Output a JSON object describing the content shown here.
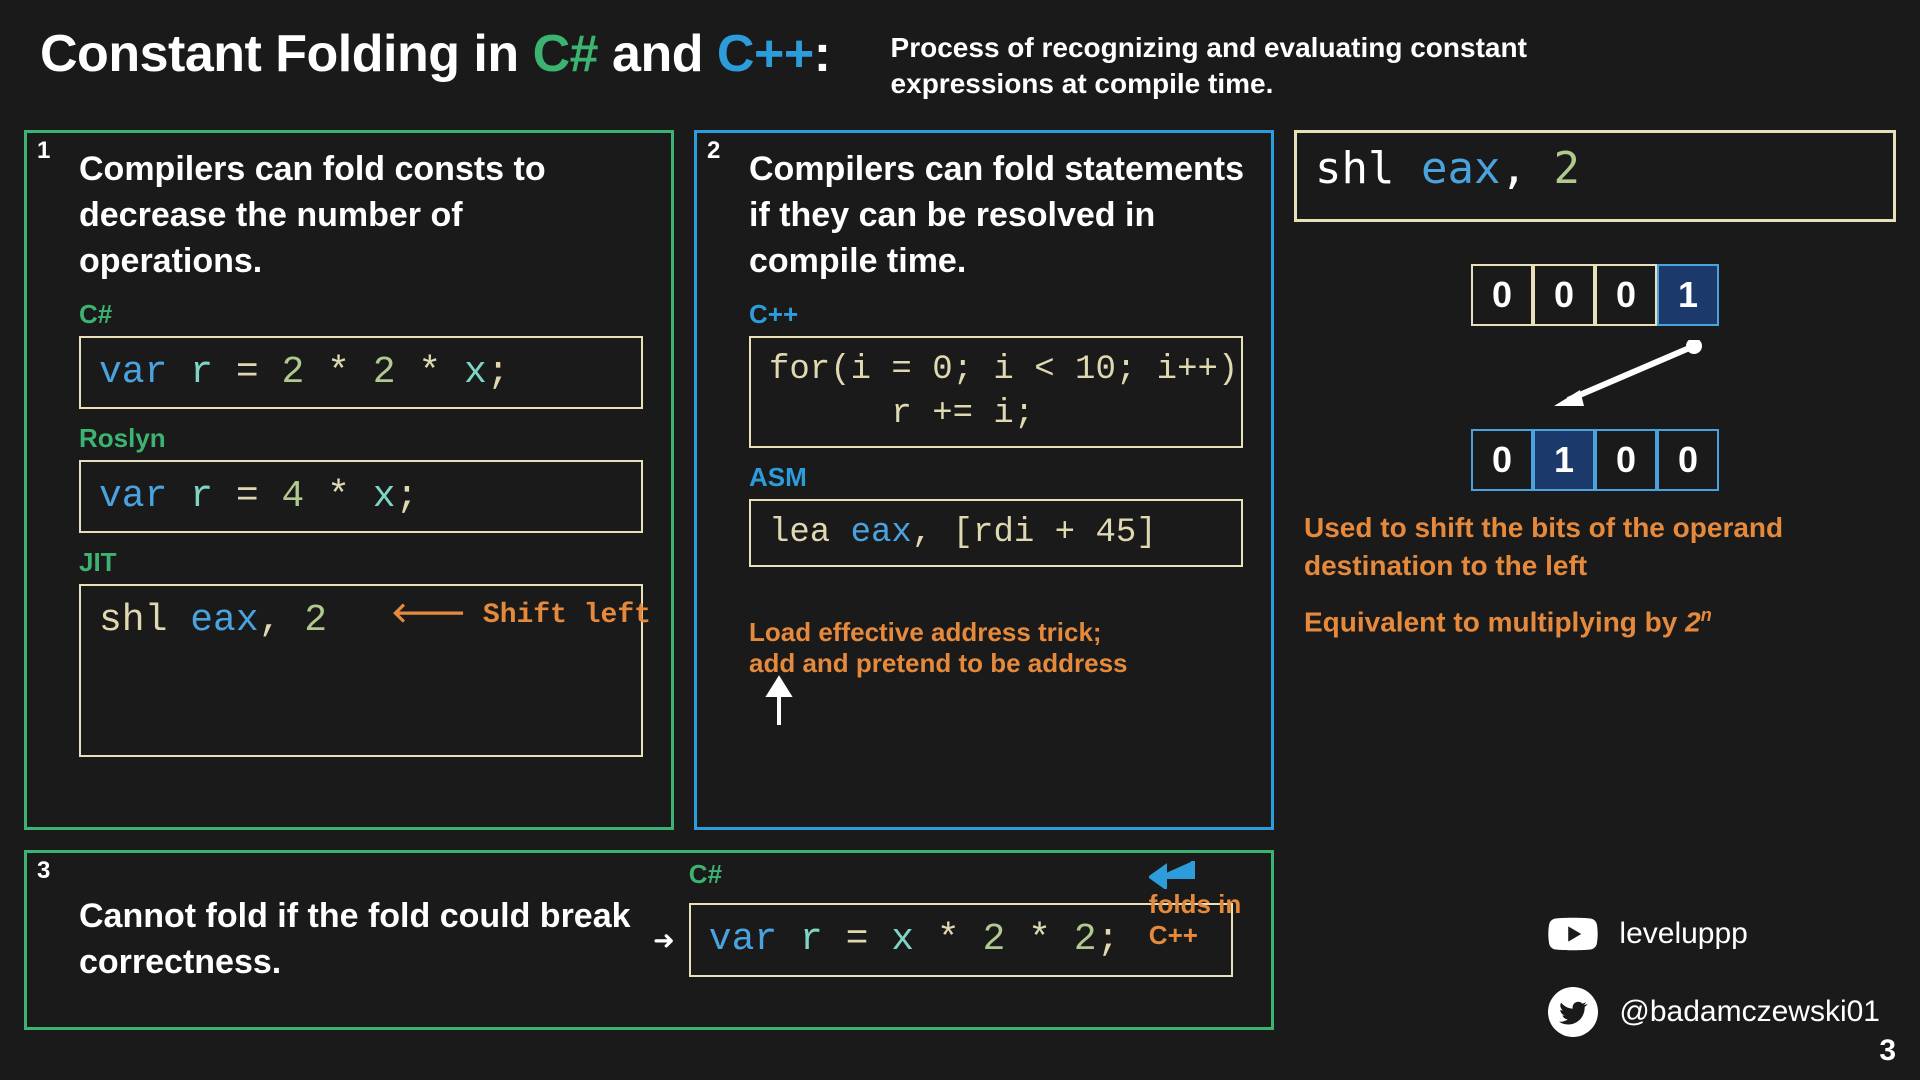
{
  "title": {
    "prefix": "Constant Folding in ",
    "csharp": "C#",
    "mid": " and ",
    "cpp": "C++",
    "suffix": ":"
  },
  "subtitle": "Process of recognizing and evaluating constant expressions at compile time.",
  "panel1": {
    "num": "1",
    "text": "Compilers can fold consts to decrease the number of operations.",
    "labels": {
      "csharp": "C#",
      "roslyn": "Roslyn",
      "jit": "JIT"
    },
    "code": {
      "csharp": {
        "var": "var",
        "r": "r",
        "eq": "=",
        "two1": "2",
        "star1": "*",
        "two2": "2",
        "star2": "*",
        "x": "x",
        "semi": ";"
      },
      "roslyn": {
        "var": "var",
        "r": "r",
        "eq": "=",
        "four": "4",
        "star": "*",
        "x": "x",
        "semi": ";"
      },
      "jit": {
        "shl": "shl",
        "eax": "eax",
        "comma": ",",
        "two": "2"
      }
    },
    "shiftleft": "Shift left"
  },
  "panel2": {
    "num": "2",
    "text": "Compilers can fold statements if they can be resolved in compile time.",
    "labels": {
      "cpp": "C++",
      "asm": "ASM"
    },
    "code": {
      "cpp": "for(i = 0; i < 10; i++)\n      r += i;",
      "asm": {
        "lea": "lea",
        "eax": "eax",
        "comma": ",",
        "br": "[rdi + 45]"
      }
    },
    "note": "Load effective address trick;\nadd and pretend to be address"
  },
  "panel3": {
    "num": "3",
    "text": "Cannot fold if the fold could break correctness.",
    "label": "C#",
    "folds": "folds in C++",
    "code": {
      "var": "var",
      "r": "r",
      "eq": "=",
      "x": "x",
      "star1": "*",
      "two1": "2",
      "star2": "*",
      "two2": "2",
      "semi": ";"
    }
  },
  "shlpanel": {
    "code": {
      "shl": "shl",
      "eax": "eax",
      "comma": ",",
      "two": "2"
    },
    "bits1": [
      "0",
      "0",
      "0",
      "1"
    ],
    "bits2": [
      "0",
      "1",
      "0",
      "0"
    ],
    "note1": "Used to shift the bits of the operand destination to the left",
    "note2a": "Equivalent to multiplying by ",
    "note2b": "2",
    "note2c": "n"
  },
  "social": {
    "youtube": "leveluppp",
    "twitter": "@badamczewski01"
  },
  "pagenum": "3"
}
